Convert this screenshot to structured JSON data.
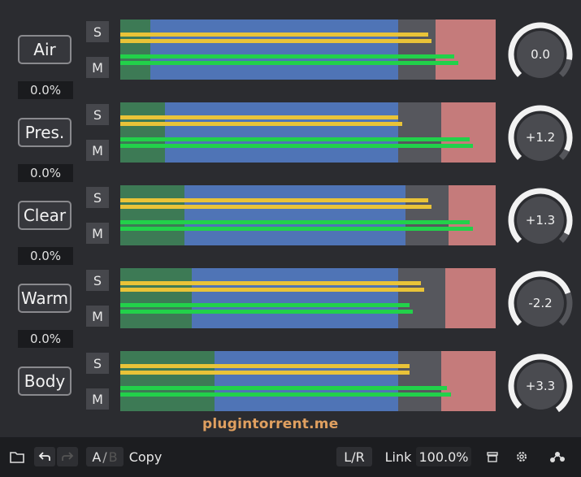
{
  "bands": [
    {
      "label": "Air",
      "percent": "0.0%",
      "solo": "S",
      "mute": "M",
      "knob_value": "0.0",
      "knob_level": 0.0,
      "meter": {
        "green_end": 0.08,
        "blue_end": 0.74,
        "gray_end": 0.84
      },
      "bars": [
        {
          "kind": "y",
          "len": 0.82
        },
        {
          "kind": "y",
          "len": 0.83
        },
        {
          "kind": "g",
          "len": 0.89
        },
        {
          "kind": "g",
          "len": 0.9
        }
      ]
    },
    {
      "label": "Pres.",
      "percent": "0.0%",
      "solo": "S",
      "mute": "M",
      "knob_value": "+1.2",
      "knob_level": 1.2,
      "meter": {
        "green_end": 0.12,
        "blue_end": 0.74,
        "gray_end": 0.855
      },
      "bars": [
        {
          "kind": "y",
          "len": 0.74
        },
        {
          "kind": "y",
          "len": 0.75
        },
        {
          "kind": "g",
          "len": 0.93
        },
        {
          "kind": "g",
          "len": 0.94
        }
      ]
    },
    {
      "label": "Clear",
      "percent": "0.0%",
      "solo": "S",
      "mute": "M",
      "knob_value": "+1.3",
      "knob_level": 1.3,
      "meter": {
        "green_end": 0.17,
        "blue_end": 0.76,
        "gray_end": 0.875
      },
      "bars": [
        {
          "kind": "y",
          "len": 0.82
        },
        {
          "kind": "y",
          "len": 0.83
        },
        {
          "kind": "g",
          "len": 0.93
        },
        {
          "kind": "g",
          "len": 0.94
        }
      ]
    },
    {
      "label": "Warm",
      "percent": "0.0%",
      "solo": "S",
      "mute": "M",
      "knob_value": "-2.2",
      "knob_level": -2.2,
      "meter": {
        "green_end": 0.19,
        "blue_end": 0.74,
        "gray_end": 0.865
      },
      "bars": [
        {
          "kind": "y",
          "len": 0.8
        },
        {
          "kind": "y",
          "len": 0.81
        },
        {
          "kind": "g",
          "len": 0.77
        },
        {
          "kind": "g",
          "len": 0.78
        }
      ]
    },
    {
      "label": "Body",
      "percent": "",
      "solo": "S",
      "mute": "M",
      "knob_value": "+3.3",
      "knob_level": 3.3,
      "meter": {
        "green_end": 0.25,
        "blue_end": 0.74,
        "gray_end": 0.855
      },
      "bars": [
        {
          "kind": "y",
          "len": 0.77
        },
        {
          "kind": "y",
          "len": 0.77
        },
        {
          "kind": "g",
          "len": 0.87
        },
        {
          "kind": "g",
          "len": 0.88
        }
      ]
    }
  ],
  "watermark": "plugintorrent.me",
  "footer": {
    "ab_a": "A",
    "ab_sep": "/",
    "ab_b": "B",
    "copy": "Copy",
    "lr": "L/R",
    "link_label": "Link",
    "link_value": "100.0%"
  },
  "colors": {
    "meter_green": "#3d7a55",
    "meter_blue": "#4f74b6",
    "meter_gray": "#56575d",
    "meter_red": "#c57b7b",
    "bar_yellow": "#e9c338",
    "bar_green": "#22d14a",
    "knob_arc": "#f2f2f2",
    "knob_track": "#55565b"
  },
  "icons": [
    "folder-icon",
    "undo-icon",
    "redo-icon",
    "compare-icon",
    "settings-icon",
    "nodes-icon"
  ]
}
